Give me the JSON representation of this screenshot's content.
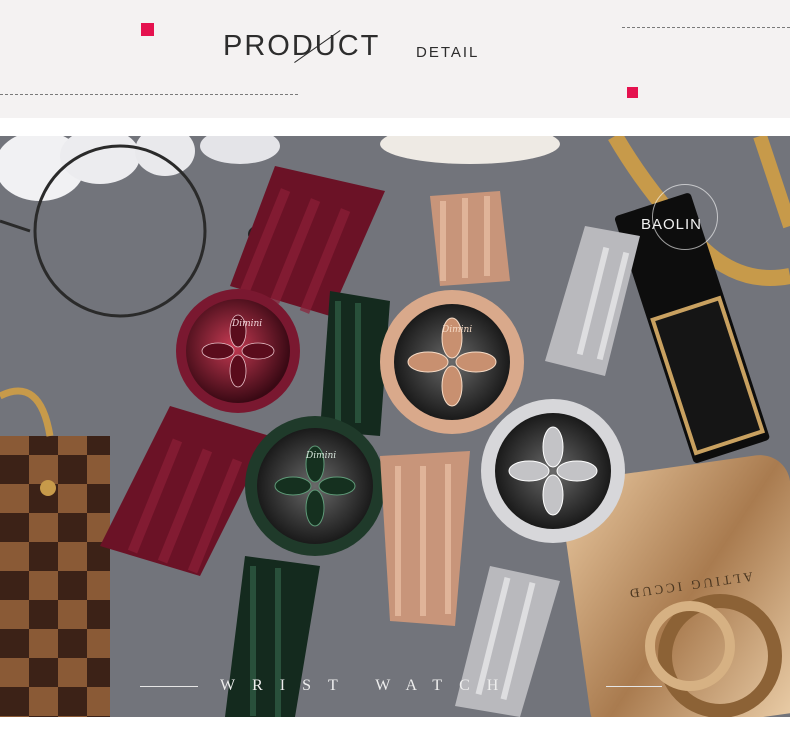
{
  "header": {
    "title": "PRODUCT",
    "subtitle": "DETAIL",
    "accent_color": "#e5124f"
  },
  "photo": {
    "brand_mark": "BAOLIN",
    "caption": "WRIST WATCH",
    "watch_brand": "Dimini",
    "engraving": "ALTIUG ICCUĐ",
    "watch_colors": [
      "#6b1226",
      "#1f3a2a",
      "#c8957a",
      "#c9c9cc"
    ]
  }
}
